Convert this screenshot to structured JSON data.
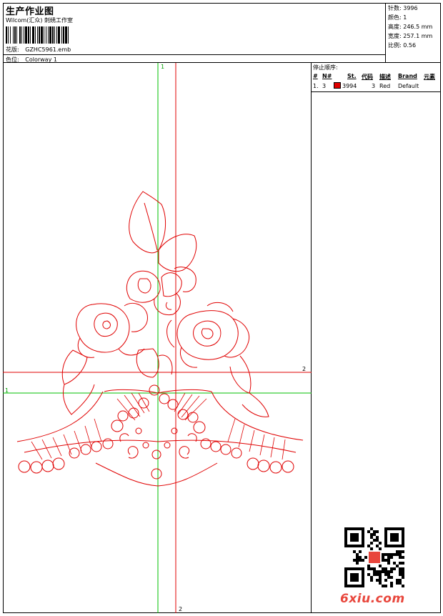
{
  "header": {
    "title": "生产作业图",
    "company": "Wilcom(汇众) 刺绣工作室",
    "design_label": "花版:",
    "design_value": "GZHC5961.emb",
    "colorway_label": "色位:",
    "colorway_value": "Colorway 1"
  },
  "stats": [
    {
      "label": "针数:",
      "value": "3996"
    },
    {
      "label": "颜色:",
      "value": "1"
    },
    {
      "label": "高度:",
      "value": "246.5 mm"
    },
    {
      "label": "宽度:",
      "value": "257.1 mm"
    },
    {
      "label": "比例:",
      "value": "0.56"
    }
  ],
  "stop_sequence": {
    "title": "停止顺序:",
    "columns": [
      "#",
      "N#",
      "St.",
      "代码",
      "描述",
      "Brand",
      "元素"
    ],
    "rows": [
      {
        "index": "1.",
        "needle": "3",
        "stitches": "3994",
        "code": "3",
        "description": "Red",
        "brand": "Default",
        "color": "#e00000"
      }
    ]
  },
  "guides": {
    "green_label": "1",
    "red_label": "2"
  },
  "watermark": "6xiu.com",
  "colors": {
    "guide_green": "#00c000",
    "guide_red": "#e00000",
    "stitch": "#e00000"
  }
}
